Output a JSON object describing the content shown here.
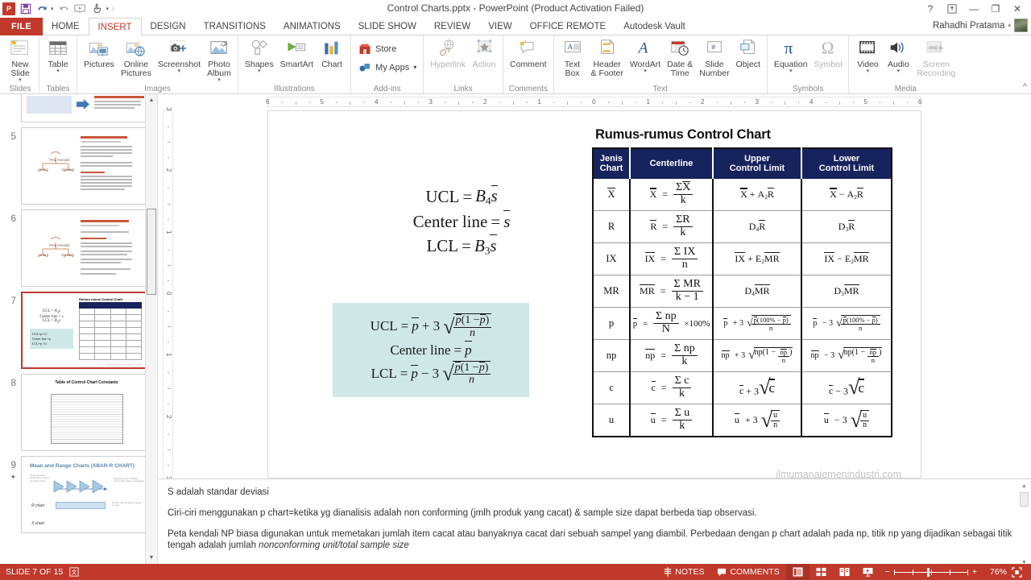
{
  "window": {
    "title": "Control Charts.pptx - PowerPoint (Product Activation Failed)",
    "help_icon": "?",
    "ribbon_display_icon": "ribbon-options-icon",
    "minimize": "—",
    "restore": "❐",
    "close": "✕"
  },
  "quick_access": {
    "logo": "P",
    "items": [
      {
        "name": "save-icon",
        "glyph": "🖫"
      },
      {
        "name": "undo-icon",
        "glyph": "↺"
      },
      {
        "name": "redo-icon",
        "glyph": "↻"
      },
      {
        "name": "start-presentation-icon",
        "glyph": "▷"
      },
      {
        "name": "touch-mode-icon",
        "glyph": "☝"
      }
    ]
  },
  "tabs": {
    "file": "FILE",
    "items": [
      "HOME",
      "INSERT",
      "DESIGN",
      "TRANSITIONS",
      "ANIMATIONS",
      "SLIDE SHOW",
      "REVIEW",
      "VIEW",
      "OFFICE REMOTE",
      "Autodesk Vault"
    ],
    "active": "INSERT"
  },
  "account": {
    "user": "Rahadhi Pratama",
    "caret": "▾"
  },
  "ribbon": {
    "groups": [
      {
        "label": "Slides",
        "buttons": [
          {
            "label": "New\nSlide",
            "icon": "new-slide-icon",
            "dropdown": true
          }
        ]
      },
      {
        "label": "Tables",
        "buttons": [
          {
            "label": "Table",
            "icon": "table-icon",
            "dropdown": true
          }
        ]
      },
      {
        "label": "Images",
        "buttons": [
          {
            "label": "Pictures",
            "icon": "pictures-icon",
            "dropdown": false
          },
          {
            "label": "Online\nPictures",
            "icon": "online-pictures-icon",
            "dropdown": false
          },
          {
            "label": "Screenshot",
            "icon": "screenshot-icon",
            "dropdown": true
          },
          {
            "label": "Photo\nAlbum",
            "icon": "photo-album-icon",
            "dropdown": true
          }
        ]
      },
      {
        "label": "Illustrations",
        "buttons": [
          {
            "label": "Shapes",
            "icon": "shapes-icon",
            "dropdown": true
          },
          {
            "label": "SmartArt",
            "icon": "smartart-icon",
            "dropdown": false
          },
          {
            "label": "Chart",
            "icon": "chart-icon",
            "dropdown": false
          }
        ]
      },
      {
        "label": "Add-ins",
        "small_buttons": [
          {
            "label": "Store",
            "icon": "store-icon"
          },
          {
            "label": "My Apps",
            "icon": "my-apps-icon",
            "dropdown": true
          }
        ]
      },
      {
        "label": "Links",
        "buttons": [
          {
            "label": "Hyperlink",
            "icon": "hyperlink-icon",
            "disabled": true
          },
          {
            "label": "Action",
            "icon": "action-icon",
            "disabled": true
          }
        ]
      },
      {
        "label": "Comments",
        "buttons": [
          {
            "label": "Comment",
            "icon": "comment-icon"
          }
        ]
      },
      {
        "label": "Text",
        "buttons": [
          {
            "label": "Text\nBox",
            "icon": "text-box-icon"
          },
          {
            "label": "Header\n& Footer",
            "icon": "header-footer-icon"
          },
          {
            "label": "WordArt",
            "icon": "wordart-icon",
            "dropdown": true
          },
          {
            "label": "Date &\nTime",
            "icon": "date-time-icon"
          },
          {
            "label": "Slide\nNumber",
            "icon": "slide-number-icon"
          },
          {
            "label": "Object",
            "icon": "object-icon"
          }
        ]
      },
      {
        "label": "Symbols",
        "buttons": [
          {
            "label": "Equation",
            "icon": "equation-icon",
            "dropdown": true
          },
          {
            "label": "Symbol",
            "icon": "symbol-icon",
            "disabled": true
          }
        ]
      },
      {
        "label": "Media",
        "buttons": [
          {
            "label": "Video",
            "icon": "video-icon",
            "dropdown": true
          },
          {
            "label": "Audio",
            "icon": "audio-icon",
            "dropdown": true
          },
          {
            "label": "Screen\nRecording",
            "icon": "screen-recording-icon",
            "disabled": true
          }
        ]
      }
    ],
    "collapse_icon": "^"
  },
  "thumbnails": {
    "visible": [
      {
        "number": "4",
        "title": ""
      },
      {
        "number": "5",
        "title": "Peta Kendali Atribut"
      },
      {
        "number": "6",
        "title": "Peta Kendali Variabel"
      },
      {
        "number": "7",
        "title": "Rumus-rumus Control Chart",
        "selected": true
      },
      {
        "number": "8",
        "title": "Table of Control Chart Constants"
      },
      {
        "number": "9",
        "title": "Mean and Range Charts (XBAR-R CHART)"
      }
    ]
  },
  "rulers": {
    "horizontal_labels": [
      "6",
      "5",
      "4",
      "3",
      "2",
      "1",
      "0",
      "1",
      "2",
      "3",
      "4",
      "5",
      "6"
    ],
    "vertical_labels": [
      "3",
      "2",
      "1",
      "0",
      "1",
      "2",
      "3"
    ]
  },
  "slide": {
    "formula_top": {
      "line1_lhs": "UCL",
      "line1_eq": "=",
      "line1_rhs_base": "B",
      "line1_rhs_sub": "4",
      "line1_rhs_var": "s",
      "line2_lhs": "Center line",
      "line2_eq": "=",
      "line2_rhs_var": "s",
      "line3_lhs": "LCL",
      "line3_eq": "=",
      "line3_rhs_base": "B",
      "line3_rhs_sub": "3",
      "line3_rhs_var": "s"
    },
    "formula_box": {
      "ucl_label": "UCL",
      "center_label": "Center line",
      "lcl_label": "LCL",
      "p_var": "p",
      "plus": "+ 3",
      "minus": "− 3",
      "numerator": "(1 −",
      "denominator": "n",
      "bg_color": "#cfe7e7"
    },
    "table": {
      "title": "Rumus-rumus Control Chart",
      "header_color": "#17235c",
      "headers": [
        "Jenis\nChart",
        "Centerline",
        "Upper\nControl Limit",
        "Lower\nControl Limit"
      ],
      "rows": [
        {
          "chart": "X",
          "centerline": "X = ΣX / k",
          "ucl": "X + A₂R",
          "lcl": "X − A₂R"
        },
        {
          "chart": "R",
          "centerline": "R = ΣR / k",
          "ucl": "D₄R",
          "lcl": "D₃R"
        },
        {
          "chart": "IX",
          "centerline": "IX = ΣIX / n",
          "ucl": "IX + E₂MR",
          "lcl": "IX − E₂MR"
        },
        {
          "chart": "MR",
          "centerline": "MR = ΣMR / (k − 1)",
          "ucl": "D₄MR",
          "lcl": "D₃MR"
        },
        {
          "chart": "p",
          "centerline": "p = Σnp / N × 100%",
          "ucl": "p + 3√(p(100% − p)/n)",
          "lcl": "p − 3√(p(100% − p)/n)"
        },
        {
          "chart": "np",
          "centerline": "np = Σnp / k",
          "ucl": "np + 3√(np(1 − np/n))",
          "lcl": "np − 3√(np(1 − np/n))"
        },
        {
          "chart": "c",
          "centerline": "c = Σc / k",
          "ucl": "c + 3√c",
          "lcl": "c − 3√c"
        },
        {
          "chart": "u",
          "centerline": "u = Σu / k",
          "ucl": "u + 3√(u/n)",
          "lcl": "u − 3√(u/n)"
        }
      ],
      "watermark": "ilmumanajemenindustri.com"
    }
  },
  "notes": {
    "paragraphs": [
      "S adalah standar deviasi",
      "Ciri-ciri menggunakan p chart=ketika  yg dianalisis adalah non conforming (jmlh produk yang cacat) & sample size dapat berbeda tiap observasi.",
      "Peta kendali NP biasa digunakan untuk memetakan jumlah item cacat atau banyaknya cacat dari sebuah sampel yang diambil. Perbedaan dengan p chart adalah pada np, titik np yang dijadikan sebagai titik tengah adalah jumlah "
    ],
    "italic_tail": "nonconforming unit/total sample size"
  },
  "status": {
    "slide_indicator": "SLIDE 7 OF 15",
    "language_icon": "language-icon",
    "notes_label": "NOTES",
    "comments_label": "COMMENTS",
    "views": [
      "normal-view-icon",
      "slide-sorter-icon",
      "reading-view-icon",
      "slideshow-icon"
    ],
    "active_view": "normal-view-icon",
    "zoom_out": "−",
    "zoom_in": "+",
    "zoom_level": "76%",
    "fit_icon": "fit-slide-icon",
    "bar_color": "#c0392b"
  }
}
